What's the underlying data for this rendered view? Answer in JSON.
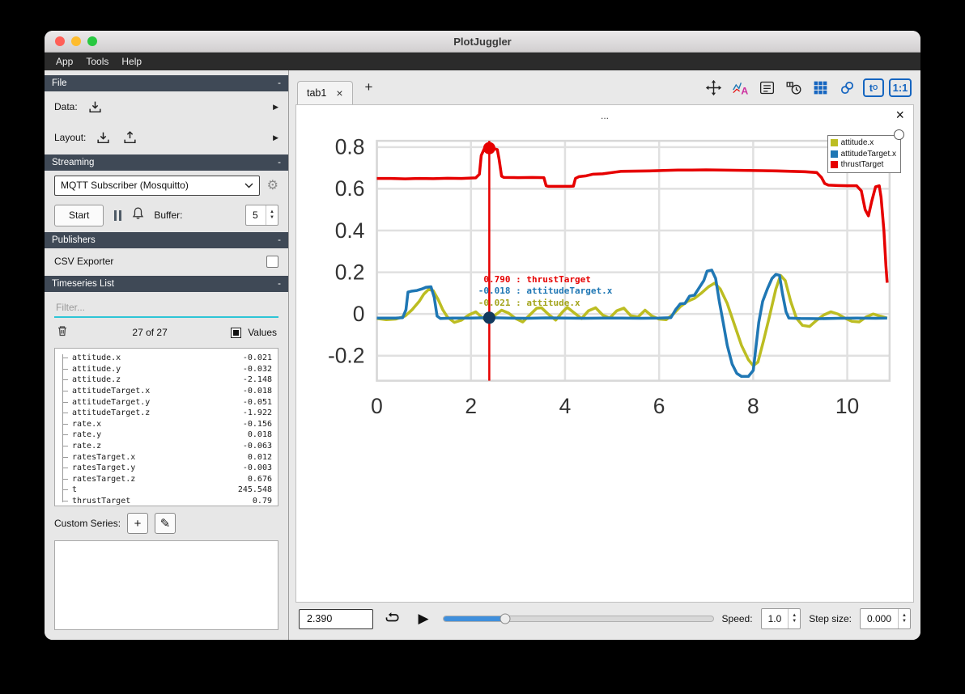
{
  "window": {
    "title": "PlotJuggler"
  },
  "menu": {
    "app": "App",
    "tools": "Tools",
    "help": "Help"
  },
  "glyphs": {
    "collapse": "-",
    "expander": "▶",
    "up": "▲",
    "down": "▼",
    "close": "×",
    "plus": "+",
    "pencil": "✎",
    "play": "▶",
    "gear": "⚙"
  },
  "sidebar": {
    "file": {
      "header": "File",
      "data_label": "Data:",
      "layout_label": "Layout:"
    },
    "streaming": {
      "header": "Streaming",
      "source": "MQTT Subscriber (Mosquitto)",
      "start": "Start",
      "buffer_label": "Buffer:",
      "buffer_value": "5"
    },
    "publishers": {
      "header": "Publishers",
      "csv_label": "CSV Exporter"
    },
    "timeseries": {
      "header": "Timeseries List",
      "filter_placeholder": "Filter...",
      "count": "27 of 27",
      "values_label": "Values",
      "custom_series_label": "Custom Series:",
      "items": [
        {
          "name": "attitude.x",
          "value": "-0.021"
        },
        {
          "name": "attitude.y",
          "value": "-0.032"
        },
        {
          "name": "attitude.z",
          "value": "-2.148"
        },
        {
          "name": "attitudeTarget.x",
          "value": "-0.018"
        },
        {
          "name": "attitudeTarget.y",
          "value": "-0.051"
        },
        {
          "name": "attitudeTarget.z",
          "value": "-1.922"
        },
        {
          "name": "rate.x",
          "value": "-0.156"
        },
        {
          "name": "rate.y",
          "value": "0.018"
        },
        {
          "name": "rate.z",
          "value": "-0.063"
        },
        {
          "name": "ratesTarget.x",
          "value": "0.012"
        },
        {
          "name": "ratesTarget.y",
          "value": "-0.003"
        },
        {
          "name": "ratesTarget.z",
          "value": "0.676"
        },
        {
          "name": "t",
          "value": "245.548"
        },
        {
          "name": "thrustTarget",
          "value": "0.79"
        }
      ]
    }
  },
  "main": {
    "tab": {
      "label": "tab1"
    },
    "toolbar": {
      "font_icon_letter": "A",
      "t0_main": "t",
      "t0_sub": "O",
      "ratio_label": "1:1"
    },
    "plot": {
      "title": "...",
      "legend": [
        {
          "label": "attitude.x",
          "color": "#bcbd22"
        },
        {
          "label": "attitudeTarget.x",
          "color": "#1f77b4"
        },
        {
          "label": "thrustTarget",
          "color": "#e60000"
        }
      ],
      "annotation": [
        {
          "text": " 0.790 : thrustTarget",
          "color": "#e60000"
        },
        {
          "text": "-0.018 : attitudeTarget.x",
          "color": "#1f77b4"
        },
        {
          "text": "-0.021 : attitude.x",
          "color": "#a3a41c"
        }
      ]
    },
    "playback": {
      "time_value": "2.390",
      "slider_pos": 0.23,
      "speed_label": "Speed:",
      "speed_value": "1.0",
      "step_label": "Step size:",
      "step_value": "0.000"
    }
  },
  "chart_data": {
    "type": "line",
    "title": "...",
    "xlabel": "",
    "ylabel": "",
    "xlim": [
      0,
      10.9
    ],
    "ylim": [
      -0.32,
      0.83
    ],
    "grid": true,
    "legend_position": "top-right",
    "x_ticks": [
      {
        "v": 0,
        "label": "0"
      },
      {
        "v": 2,
        "label": "2"
      },
      {
        "v": 4,
        "label": "4"
      },
      {
        "v": 6,
        "label": "6"
      },
      {
        "v": 8,
        "label": "8"
      },
      {
        "v": 10,
        "label": "10"
      }
    ],
    "y_ticks": [
      {
        "v": 0.8,
        "label": "0.8"
      },
      {
        "v": 0.6,
        "label": "0.6"
      },
      {
        "v": 0.4,
        "label": "0.4"
      },
      {
        "v": 0.2,
        "label": "0.2"
      },
      {
        "v": 0,
        "label": "0"
      },
      {
        "v": -0.2,
        "label": "-0.2"
      }
    ],
    "tracker": {
      "x": 2.39,
      "points": [
        {
          "y": 0.795,
          "color": "#e60000"
        },
        {
          "y": -0.018,
          "color": "#123a5e"
        }
      ]
    },
    "series": [
      {
        "name": "attitude.x",
        "color": "#bcbd22",
        "points": [
          [
            0,
            -0.022
          ],
          [
            0.2,
            -0.028
          ],
          [
            0.4,
            -0.025
          ],
          [
            0.6,
            -0.01
          ],
          [
            0.75,
            0.02
          ],
          [
            0.9,
            0.06
          ],
          [
            1.0,
            0.095
          ],
          [
            1.1,
            0.118
          ],
          [
            1.2,
            0.112
          ],
          [
            1.3,
            0.07
          ],
          [
            1.4,
            0.02
          ],
          [
            1.5,
            -0.015
          ],
          [
            1.65,
            -0.04
          ],
          [
            1.8,
            -0.03
          ],
          [
            1.95,
            -0.005
          ],
          [
            2.1,
            0.01
          ],
          [
            2.2,
            -0.01
          ],
          [
            2.3,
            -0.028
          ],
          [
            2.39,
            -0.021
          ],
          [
            2.5,
            -0.008
          ],
          [
            2.65,
            0.018
          ],
          [
            2.8,
            0.005
          ],
          [
            2.95,
            -0.022
          ],
          [
            3.1,
            -0.038
          ],
          [
            3.25,
            -0.005
          ],
          [
            3.4,
            0.028
          ],
          [
            3.5,
            0.03
          ],
          [
            3.65,
            -0.002
          ],
          [
            3.8,
            -0.03
          ],
          [
            3.95,
            0.01
          ],
          [
            4.05,
            0.032
          ],
          [
            4.2,
            0.005
          ],
          [
            4.35,
            -0.022
          ],
          [
            4.5,
            0.015
          ],
          [
            4.65,
            0.03
          ],
          [
            4.8,
            -0.005
          ],
          [
            4.95,
            -0.02
          ],
          [
            5.1,
            0.015
          ],
          [
            5.25,
            0.028
          ],
          [
            5.4,
            -0.008
          ],
          [
            5.55,
            -0.015
          ],
          [
            5.7,
            0.018
          ],
          [
            5.85,
            -0.01
          ],
          [
            6.0,
            -0.025
          ],
          [
            6.15,
            -0.028
          ],
          [
            6.3,
            0.0
          ],
          [
            6.45,
            0.035
          ],
          [
            6.6,
            0.06
          ],
          [
            6.75,
            0.075
          ],
          [
            6.9,
            0.1
          ],
          [
            7.05,
            0.13
          ],
          [
            7.18,
            0.148
          ],
          [
            7.3,
            0.12
          ],
          [
            7.45,
            0.05
          ],
          [
            7.6,
            -0.05
          ],
          [
            7.75,
            -0.15
          ],
          [
            7.9,
            -0.22
          ],
          [
            8.0,
            -0.248
          ],
          [
            8.1,
            -0.23
          ],
          [
            8.22,
            -0.13
          ],
          [
            8.35,
            -0.01
          ],
          [
            8.48,
            0.12
          ],
          [
            8.58,
            0.185
          ],
          [
            8.68,
            0.16
          ],
          [
            8.8,
            0.06
          ],
          [
            8.92,
            -0.02
          ],
          [
            9.05,
            -0.055
          ],
          [
            9.2,
            -0.06
          ],
          [
            9.35,
            -0.03
          ],
          [
            9.5,
            -0.005
          ],
          [
            9.65,
            0.01
          ],
          [
            9.8,
            0.0
          ],
          [
            9.95,
            -0.02
          ],
          [
            10.1,
            -0.035
          ],
          [
            10.25,
            -0.038
          ],
          [
            10.4,
            -0.015
          ],
          [
            10.55,
            0.0
          ],
          [
            10.7,
            -0.01
          ],
          [
            10.85,
            -0.02
          ]
        ]
      },
      {
        "name": "attitudeTarget.x",
        "color": "#1f77b4",
        "points": [
          [
            0,
            -0.02
          ],
          [
            0.4,
            -0.02
          ],
          [
            0.55,
            -0.018
          ],
          [
            0.62,
            0.02
          ],
          [
            0.66,
            0.105
          ],
          [
            0.75,
            0.11
          ],
          [
            0.85,
            0.113
          ],
          [
            0.95,
            0.12
          ],
          [
            1.05,
            0.128
          ],
          [
            1.15,
            0.13
          ],
          [
            1.22,
            0.08
          ],
          [
            1.28,
            -0.01
          ],
          [
            1.35,
            -0.022
          ],
          [
            1.6,
            -0.02
          ],
          [
            2.0,
            -0.02
          ],
          [
            2.39,
            -0.018
          ],
          [
            2.8,
            -0.02
          ],
          [
            3.2,
            -0.021
          ],
          [
            3.6,
            -0.019
          ],
          [
            4.0,
            -0.02
          ],
          [
            4.4,
            -0.021
          ],
          [
            4.8,
            -0.02
          ],
          [
            5.2,
            -0.02
          ],
          [
            5.6,
            -0.021
          ],
          [
            6.0,
            -0.02
          ],
          [
            6.25,
            -0.018
          ],
          [
            6.35,
            0.02
          ],
          [
            6.45,
            0.048
          ],
          [
            6.55,
            0.05
          ],
          [
            6.65,
            0.085
          ],
          [
            6.75,
            0.09
          ],
          [
            6.85,
            0.125
          ],
          [
            6.95,
            0.16
          ],
          [
            7.02,
            0.205
          ],
          [
            7.12,
            0.21
          ],
          [
            7.2,
            0.17
          ],
          [
            7.28,
            0.06
          ],
          [
            7.36,
            -0.04
          ],
          [
            7.45,
            -0.15
          ],
          [
            7.55,
            -0.24
          ],
          [
            7.65,
            -0.285
          ],
          [
            7.75,
            -0.3
          ],
          [
            7.9,
            -0.3
          ],
          [
            8.0,
            -0.27
          ],
          [
            8.06,
            -0.16
          ],
          [
            8.12,
            -0.04
          ],
          [
            8.2,
            0.06
          ],
          [
            8.3,
            0.12
          ],
          [
            8.4,
            0.17
          ],
          [
            8.48,
            0.19
          ],
          [
            8.56,
            0.185
          ],
          [
            8.62,
            0.1
          ],
          [
            8.7,
            0.01
          ],
          [
            8.76,
            -0.02
          ],
          [
            9.0,
            -0.022
          ],
          [
            9.4,
            -0.023
          ],
          [
            9.8,
            -0.021
          ],
          [
            10.2,
            -0.02
          ],
          [
            10.6,
            -0.021
          ],
          [
            10.85,
            -0.02
          ]
        ]
      },
      {
        "name": "thrustTarget",
        "color": "#e60000",
        "points": [
          [
            0,
            0.65
          ],
          [
            0.3,
            0.65
          ],
          [
            0.6,
            0.648
          ],
          [
            0.9,
            0.65
          ],
          [
            1.2,
            0.649
          ],
          [
            1.5,
            0.651
          ],
          [
            1.8,
            0.65
          ],
          [
            2.0,
            0.652
          ],
          [
            2.1,
            0.653
          ],
          [
            2.18,
            0.67
          ],
          [
            2.22,
            0.76
          ],
          [
            2.28,
            0.79
          ],
          [
            2.4,
            0.795
          ],
          [
            2.5,
            0.792
          ],
          [
            2.56,
            0.788
          ],
          [
            2.6,
            0.74
          ],
          [
            2.65,
            0.66
          ],
          [
            2.7,
            0.655
          ],
          [
            3.0,
            0.654
          ],
          [
            3.3,
            0.655
          ],
          [
            3.55,
            0.654
          ],
          [
            3.6,
            0.615
          ],
          [
            3.65,
            0.612
          ],
          [
            4.1,
            0.612
          ],
          [
            4.18,
            0.613
          ],
          [
            4.22,
            0.65
          ],
          [
            4.3,
            0.658
          ],
          [
            4.45,
            0.662
          ],
          [
            4.6,
            0.67
          ],
          [
            4.8,
            0.672
          ],
          [
            5.0,
            0.678
          ],
          [
            5.2,
            0.684
          ],
          [
            5.5,
            0.685
          ],
          [
            5.8,
            0.686
          ],
          [
            6.1,
            0.688
          ],
          [
            6.4,
            0.69
          ],
          [
            6.7,
            0.69
          ],
          [
            7.0,
            0.691
          ],
          [
            7.3,
            0.69
          ],
          [
            7.6,
            0.689
          ],
          [
            7.9,
            0.688
          ],
          [
            8.2,
            0.687
          ],
          [
            8.5,
            0.686
          ],
          [
            8.8,
            0.684
          ],
          [
            9.1,
            0.682
          ],
          [
            9.35,
            0.678
          ],
          [
            9.45,
            0.655
          ],
          [
            9.52,
            0.625
          ],
          [
            9.6,
            0.618
          ],
          [
            9.8,
            0.616
          ],
          [
            10.0,
            0.615
          ],
          [
            10.2,
            0.615
          ],
          [
            10.3,
            0.59
          ],
          [
            10.38,
            0.5
          ],
          [
            10.45,
            0.47
          ],
          [
            10.52,
            0.54
          ],
          [
            10.6,
            0.61
          ],
          [
            10.68,
            0.615
          ],
          [
            10.72,
            0.56
          ],
          [
            10.78,
            0.4
          ],
          [
            10.82,
            0.23
          ],
          [
            10.85,
            0.15
          ]
        ]
      }
    ]
  }
}
